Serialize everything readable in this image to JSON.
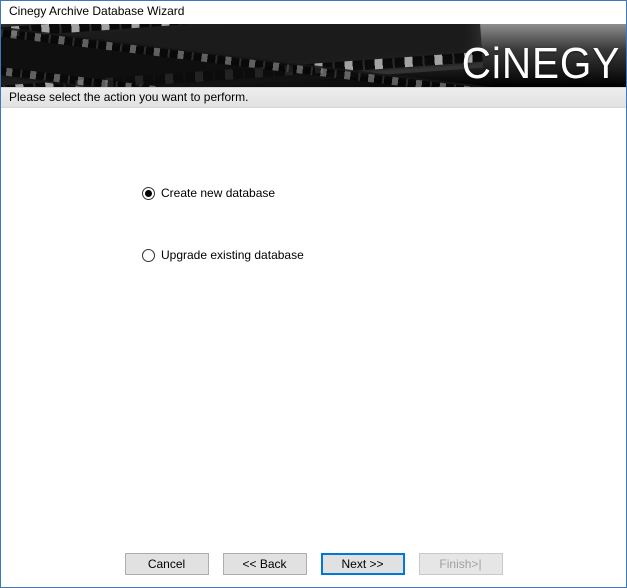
{
  "window": {
    "title": "Cinegy Archive Database Wizard"
  },
  "banner": {
    "brand": "CiNEGY"
  },
  "instruction": "Please select the action you want to perform.",
  "options": {
    "create": {
      "label": "Create new database",
      "checked": true
    },
    "upgrade": {
      "label": "Upgrade existing database",
      "checked": false
    }
  },
  "buttons": {
    "cancel": "Cancel",
    "back": "<< Back",
    "next": "Next >>",
    "finish": "Finish>|",
    "finish_enabled": false
  }
}
